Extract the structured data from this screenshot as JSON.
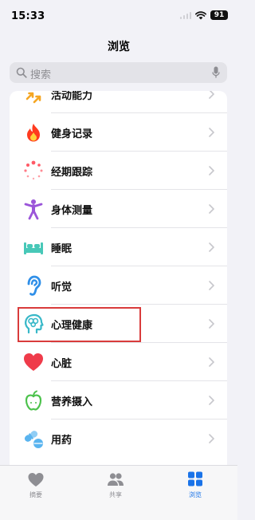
{
  "status_bar": {
    "time": "15:33",
    "battery": "91"
  },
  "nav": {
    "title": "浏览"
  },
  "search": {
    "placeholder": "搜索"
  },
  "list": {
    "items": [
      {
        "label": "活动能力",
        "icon": "activity-arrows-icon",
        "color": "#f5a623"
      },
      {
        "label": "健身记录",
        "icon": "flame-icon",
        "color": "#ff3b1f"
      },
      {
        "label": "经期跟踪",
        "icon": "cycle-dots-icon",
        "color": "#ff5a66"
      },
      {
        "label": "身体测量",
        "icon": "person-figure-icon",
        "color": "#9b55d9"
      },
      {
        "label": "睡眠",
        "icon": "bed-icon",
        "color": "#48c8b8"
      },
      {
        "label": "听觉",
        "icon": "ear-icon",
        "color": "#2f8fe8"
      },
      {
        "label": "心理健康",
        "icon": "head-brain-icon",
        "color": "#38b8c8"
      },
      {
        "label": "心脏",
        "icon": "heart-icon",
        "color": "#ef3b4a"
      },
      {
        "label": "营养摄入",
        "icon": "apple-icon",
        "color": "#4cc24c"
      },
      {
        "label": "用药",
        "icon": "pills-icon",
        "color": "#5ab4ef"
      }
    ]
  },
  "highlight": {
    "color": "#d93b3b",
    "target": "心理健康"
  },
  "tabs": [
    {
      "label": "摘要",
      "icon": "heart-icon",
      "active": false
    },
    {
      "label": "共享",
      "icon": "people-icon",
      "active": false
    },
    {
      "label": "浏览",
      "icon": "grid-icon",
      "active": true
    }
  ],
  "colors": {
    "accent": "#1a73e8",
    "inactive": "#8e8e93",
    "background": "#f2f2f7"
  }
}
